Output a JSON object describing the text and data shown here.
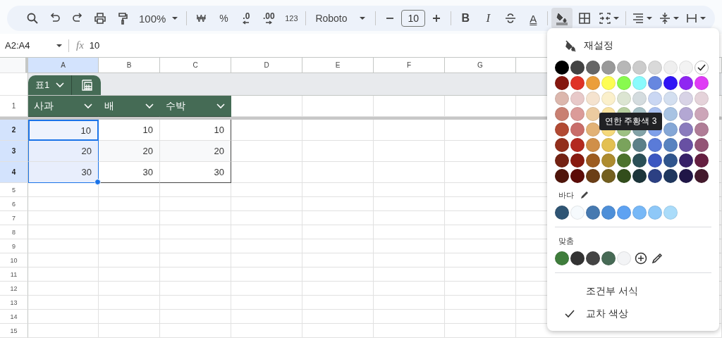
{
  "toolbar": {
    "zoom": "100%",
    "currency": "₩",
    "percent": "%",
    "decimal_decrease": ".0",
    "decimal_increase": ".00",
    "number_format": "123",
    "font": "Roboto",
    "font_size": "10",
    "bold": "B",
    "italic": "I",
    "text_color": "A",
    "fill_active": true
  },
  "formula_bar": {
    "name_box": "A2:A4",
    "fx": "fx",
    "value": "10"
  },
  "sheet": {
    "columns": [
      {
        "label": "A",
        "selected": true
      },
      {
        "label": "B",
        "selected": false
      },
      {
        "label": "C",
        "selected": false
      },
      {
        "label": "D",
        "selected": false
      },
      {
        "label": "E",
        "selected": false
      },
      {
        "label": "F",
        "selected": false
      },
      {
        "label": "G",
        "selected": false
      }
    ],
    "table": {
      "name": "표1",
      "header_row": "1",
      "headers": [
        "사과",
        "배",
        "수박"
      ],
      "rows": [
        {
          "number": "2",
          "selected": true,
          "cells": [
            "10",
            "10",
            "10"
          ]
        },
        {
          "number": "3",
          "selected": true,
          "cells": [
            "20",
            "20",
            "20"
          ]
        },
        {
          "number": "4",
          "selected": true,
          "cells": [
            "30",
            "30",
            "30"
          ]
        }
      ]
    },
    "empty_rows": [
      "5",
      "6",
      "7",
      "8",
      "9",
      "10",
      "11",
      "12",
      "13",
      "14",
      "15"
    ]
  },
  "fill_menu": {
    "reset": "재설정",
    "palette": [
      [
        {
          "color": "#000000",
          "selected": false
        },
        {
          "color": "#434343",
          "selected": false
        },
        {
          "color": "#666666",
          "selected": false
        },
        {
          "color": "#999999",
          "selected": false
        },
        {
          "color": "#b7b7b7",
          "selected": false
        },
        {
          "color": "#cccccc",
          "selected": false
        },
        {
          "color": "#d9d9d9",
          "selected": false
        },
        {
          "color": "#efefef",
          "selected": false
        },
        {
          "color": "#f3f3f3",
          "selected": false
        },
        {
          "color": "#ffffff",
          "selected": true
        }
      ],
      [
        {
          "color": "#85170f",
          "selected": false
        },
        {
          "color": "#df3226",
          "selected": false
        },
        {
          "color": "#eb9e3a",
          "selected": false
        },
        {
          "color": "#fdfd53",
          "selected": false
        },
        {
          "color": "#88fa4e",
          "selected": false
        },
        {
          "color": "#8afbfd",
          "selected": false
        },
        {
          "color": "#6787e0",
          "selected": false
        },
        {
          "color": "#2f14f5",
          "selected": false
        },
        {
          "color": "#8f26f2",
          "selected": false
        },
        {
          "color": "#df3bf5",
          "selected": false
        }
      ],
      [
        {
          "color": "#dcb7ad",
          "selected": false
        },
        {
          "color": "#e8c9c9",
          "selected": false
        },
        {
          "color": "#f5e3cf",
          "selected": false
        },
        {
          "color": "#fbf0cb",
          "selected": false
        },
        {
          "color": "#dce5d2",
          "selected": false
        },
        {
          "color": "#d4dcdf",
          "selected": false
        },
        {
          "color": "#cad7f3",
          "selected": false
        },
        {
          "color": "#d3dff0",
          "selected": false
        },
        {
          "color": "#d8d3e6",
          "selected": false
        },
        {
          "color": "#e5d3da",
          "selected": false
        }
      ],
      [
        {
          "color": "#c98072",
          "selected": false
        },
        {
          "color": "#db9b99",
          "selected": false
        },
        {
          "color": "#eccba0",
          "selected": false
        },
        {
          "color": "#f9e29e",
          "selected": false
        },
        {
          "color": "#b7cf9e",
          "selected": false
        },
        {
          "color": "#a6c1c6",
          "selected": false
        },
        {
          "color": "#a9c0f0",
          "selected": false
        },
        {
          "color": "#a8c3e3",
          "selected": false
        },
        {
          "color": "#b3a7d3",
          "selected": false
        },
        {
          "color": "#cca5b8",
          "selected": false
        }
      ],
      [
        {
          "color": "#b24a33",
          "selected": false
        },
        {
          "color": "#c96d6a",
          "selected": false
        },
        {
          "color": "#e2b276",
          "selected": false
        },
        {
          "color": "#f5d97b",
          "selected": false
        },
        {
          "color": "#9ec183",
          "selected": false
        },
        {
          "color": "#83a3a8",
          "selected": false
        },
        {
          "color": "#7fa0ea",
          "selected": false
        },
        {
          "color": "#85a7d6",
          "selected": false
        },
        {
          "color": "#8a7bbd",
          "selected": false
        },
        {
          "color": "#b07d97",
          "selected": false
        }
      ],
      [
        {
          "color": "#932f1c",
          "selected": false
        },
        {
          "color": "#b3291f",
          "selected": false
        },
        {
          "color": "#d08f49",
          "selected": false
        },
        {
          "color": "#e3c052",
          "selected": false
        },
        {
          "color": "#7aa35c",
          "selected": false
        },
        {
          "color": "#5c8089",
          "selected": false
        },
        {
          "color": "#5a7bd8",
          "selected": false
        },
        {
          "color": "#5883c0",
          "selected": false
        },
        {
          "color": "#6850a3",
          "selected": false
        },
        {
          "color": "#945476",
          "selected": false
        }
      ],
      [
        {
          "color": "#742213",
          "selected": false
        },
        {
          "color": "#891a10",
          "selected": false
        },
        {
          "color": "#9d5c20",
          "selected": false
        },
        {
          "color": "#ae8c2f",
          "selected": false
        },
        {
          "color": "#4c722d",
          "selected": false
        },
        {
          "color": "#2b5057",
          "selected": false
        },
        {
          "color": "#3c57c1",
          "selected": false
        },
        {
          "color": "#30558d",
          "selected": false
        },
        {
          "color": "#372168",
          "selected": false
        },
        {
          "color": "#651f41",
          "selected": false
        }
      ],
      [
        {
          "color": "#4f140a",
          "selected": false
        },
        {
          "color": "#5c0c07",
          "selected": false
        },
        {
          "color": "#6b3e16",
          "selected": false
        },
        {
          "color": "#735f1f",
          "selected": false
        },
        {
          "color": "#324d1c",
          "selected": false
        },
        {
          "color": "#1c353a",
          "selected": false
        },
        {
          "color": "#2c4083",
          "selected": false
        },
        {
          "color": "#1f375f",
          "selected": false
        },
        {
          "color": "#201647",
          "selected": false
        },
        {
          "color": "#441a2d",
          "selected": false
        }
      ]
    ],
    "tooltip": "연한 주황색 3",
    "theme_label": "바다",
    "theme_colors": [
      {
        "color": "#2f5574"
      },
      {
        "color": "#f6fafd"
      },
      {
        "color": "#4679b0"
      },
      {
        "color": "#4e8fd8"
      },
      {
        "color": "#5ea2f2"
      },
      {
        "color": "#77b8f7"
      },
      {
        "color": "#8ec8f8"
      },
      {
        "color": "#aadcfa"
      }
    ],
    "custom_label": "맞춤",
    "custom_colors": [
      {
        "color": "#3f7d3c"
      },
      {
        "color": "#333333"
      },
      {
        "color": "#444444"
      },
      {
        "color": "#476a55"
      },
      {
        "color": "#f3f4f6"
      }
    ],
    "items": [
      {
        "label": "조건부 서식",
        "checked": false
      },
      {
        "label": "교차 색상",
        "checked": true
      }
    ]
  }
}
